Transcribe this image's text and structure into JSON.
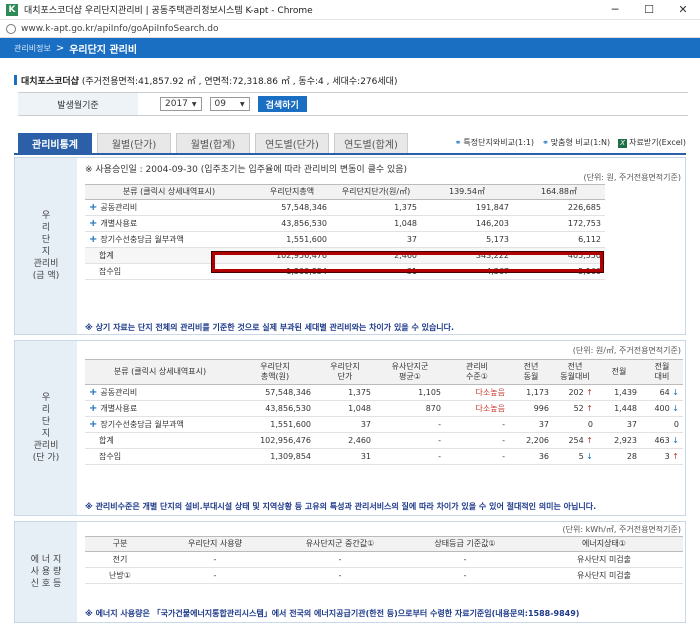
{
  "window": {
    "title": "대치포스코더샵 우리단지관리비 | 공동주택관리정보시스템 K-apt - Chrome",
    "logo": "K",
    "url": "www.k-apt.go.kr/apiInfo/goApiInfoSearch.do",
    "min_icon": "─",
    "max_icon": "☐",
    "close_icon": "✕"
  },
  "nav": {
    "crumb": "관리비정보",
    "sep": ">",
    "current": "우리단지 관리비"
  },
  "complex": {
    "name": "대치포스코더샵",
    "detail": "(주거전용면적:41,857.92 ㎡ , 연면적:72,318.86 ㎡ , 동수:4 , 세대수:276세대)"
  },
  "period": {
    "label": "발생월기준",
    "year": "2017",
    "month": "09",
    "search": "검색하기"
  },
  "tabs": [
    "관리비통계",
    "월별(단가)",
    "월별(합계)",
    "연도별(단가)",
    "연도별(합계)"
  ],
  "tablinks": {
    "compare1": "특정단지와비교(1:1)",
    "compare2": "맞춤형 비교(1:N)",
    "excel_icon": "X",
    "download": "자료받기(Excel)"
  },
  "sec1": {
    "side": [
      "우",
      "리",
      "단",
      "지",
      "관리비",
      "(금 액)"
    ],
    "note": "※ 사용승인일 : 2004-09-30 (입주초기는 입주율에 따라 관리비의 변동이 클수 있음)",
    "unit": "(단위: 원, 주거전용면적기준)",
    "headers": [
      "분류 (클릭시 상세내역표시)",
      "우리단지총액",
      "우리단지단가(원/㎡)",
      "139.54㎡",
      "164.88㎡"
    ],
    "rows": [
      {
        "label": "공동관리비",
        "plus": true,
        "v": [
          "57,548,346",
          "1,375",
          "191,847",
          "226,685"
        ]
      },
      {
        "label": "개별사용료",
        "plus": true,
        "v": [
          "43,856,530",
          "1,048",
          "146,203",
          "172,753"
        ]
      },
      {
        "label": "장기수선충당금 월부과액",
        "plus": true,
        "v": [
          "1,551,600",
          "37",
          "5,173",
          "6,112"
        ]
      },
      {
        "label": "합계",
        "plus": false,
        "v": [
          "102,956,476",
          "2,460",
          "343,222",
          "405,550"
        ]
      },
      {
        "label": "잡수입",
        "plus": false,
        "v": [
          "1,309,854",
          "31",
          "4,367",
          "5,160"
        ]
      }
    ],
    "footnote": "※ 상기 자료는 단지 전체의 관리비를 기준한 것으로 실제 부과된 세대별 관리비와는 차이가 있을 수 있습니다."
  },
  "sec2": {
    "side": [
      "우",
      "리",
      "단",
      "지",
      "관리비",
      "(단 가)"
    ],
    "unit": "(단위: 원/㎡, 주거전용면적기준)",
    "headers": [
      "분류 (클릭시 상세내역표시)",
      "우리단지\n총액(원)",
      "우리단지\n단가",
      "유사단지군\n평균①",
      "관리비\n수준①",
      "전년\n동월",
      "전년\n동월대비",
      "전월",
      "전월\n대비"
    ],
    "rows": [
      {
        "label": "공동관리비",
        "plus": true,
        "v": [
          "57,548,346",
          "1,375",
          "1,105",
          "다소높음",
          "1,173",
          "202",
          "1,439",
          "64"
        ],
        "d1": "up",
        "d2": "down"
      },
      {
        "label": "개별사용료",
        "plus": true,
        "v": [
          "43,856,530",
          "1,048",
          "870",
          "다소높음",
          "996",
          "52",
          "1,448",
          "400"
        ],
        "d1": "up",
        "d2": "down"
      },
      {
        "label": "장기수선충당금 월부과액",
        "plus": true,
        "v": [
          "1,551,600",
          "37",
          "-",
          "-",
          "37",
          "0",
          "37",
          "0"
        ],
        "d1": "",
        "d2": ""
      },
      {
        "label": "합계",
        "plus": false,
        "v": [
          "102,956,476",
          "2,460",
          "-",
          "-",
          "2,206",
          "254",
          "2,923",
          "463"
        ],
        "d1": "up",
        "d2": "down"
      },
      {
        "label": "잡수입",
        "plus": false,
        "v": [
          "1,309,854",
          "31",
          "-",
          "-",
          "36",
          "5",
          "28",
          "3"
        ],
        "d1": "down",
        "d2": "up"
      }
    ],
    "footnote": "※ 관리비수준은 개별 단지의 설비.부대시설 상태 및 지역상황 등 고유의 특성과 관리서비스의 질에 따라 차이가 있을 수 있어 절대적인 의미는 아닙니다."
  },
  "sec3": {
    "side": [
      "에 너 지",
      "사 용 량",
      "신 호 등"
    ],
    "unit": "(단위: kWh/㎡, 주거전용면적기준)",
    "headers": [
      "구분",
      "우리단지 사용량",
      "유사단지군 중간값①",
      "상태등급 기준값①",
      "에너지상태①"
    ],
    "rows": [
      {
        "v": [
          "전기",
          "-",
          "-",
          "-",
          "유사단지 미검출"
        ]
      },
      {
        "v": [
          "난방①",
          "-",
          "-",
          "-",
          "유사단지 미검출"
        ]
      }
    ],
    "footnote": "※ 에너지 사용량은 「국가건물에너지통합관리시스템」에서 전국의 에너지공급기관(한전 등)으로부터 수령한 자료기준임(내용문의:1588-9849)"
  },
  "colors": {
    "accent": "#1a6fc2",
    "tab_active": "#2b5fa8",
    "highlight": "#b00000",
    "warn": "#c0392b"
  }
}
